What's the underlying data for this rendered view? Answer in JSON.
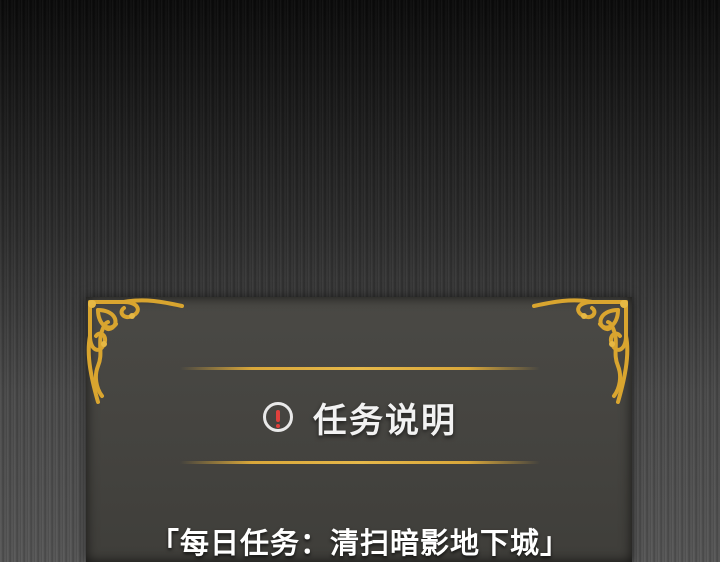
{
  "dialog": {
    "title": "任务说明",
    "icon": "alert-icon",
    "quest": "「每日任务：清扫暗影地下城」"
  },
  "colors": {
    "gold": "#d9a73a",
    "alert_red": "#e0403c",
    "panel": "#4a4945"
  }
}
